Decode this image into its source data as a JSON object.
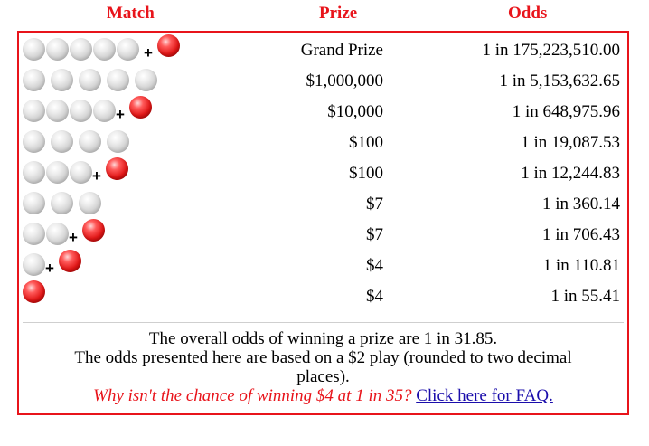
{
  "header": {
    "match": "Match",
    "prize": "Prize",
    "odds": "Odds"
  },
  "rows": [
    {
      "white": 5,
      "red": true,
      "prize": "Grand Prize",
      "odds": "1 in 175,223,510.00"
    },
    {
      "white": 5,
      "red": false,
      "prize": "$1,000,000",
      "odds": "1 in 5,153,632.65"
    },
    {
      "white": 4,
      "red": true,
      "prize": "$10,000",
      "odds": "1 in 648,975.96"
    },
    {
      "white": 4,
      "red": false,
      "prize": "$100",
      "odds": "1 in 19,087.53"
    },
    {
      "white": 3,
      "red": true,
      "prize": "$100",
      "odds": "1 in 12,244.83"
    },
    {
      "white": 3,
      "red": false,
      "prize": "$7",
      "odds": "1 in 360.14"
    },
    {
      "white": 2,
      "red": true,
      "prize": "$7",
      "odds": "1 in 706.43"
    },
    {
      "white": 1,
      "red": true,
      "prize": "$4",
      "odds": "1 in 110.81"
    },
    {
      "white": 0,
      "red": true,
      "prize": "$4",
      "odds": "1 in 55.41"
    }
  ],
  "plus_symbol": "+",
  "footer": {
    "overall_odds": "The overall odds of winning a prize are 1 in 31.85.",
    "odds_note_line1": "The odds presented here are based on a $2 play (rounded to two decimal",
    "odds_note_line2": "places).",
    "faq_question": "Why isn't the chance of winning $4 at 1 in 35?",
    "faq_link": "Click here for FAQ."
  },
  "colors": {
    "accent_red": "#e8141b",
    "link_blue": "#1a0dab"
  },
  "icons": {
    "white_ball": "white-ball-icon",
    "red_ball": "red-powerball-icon"
  }
}
